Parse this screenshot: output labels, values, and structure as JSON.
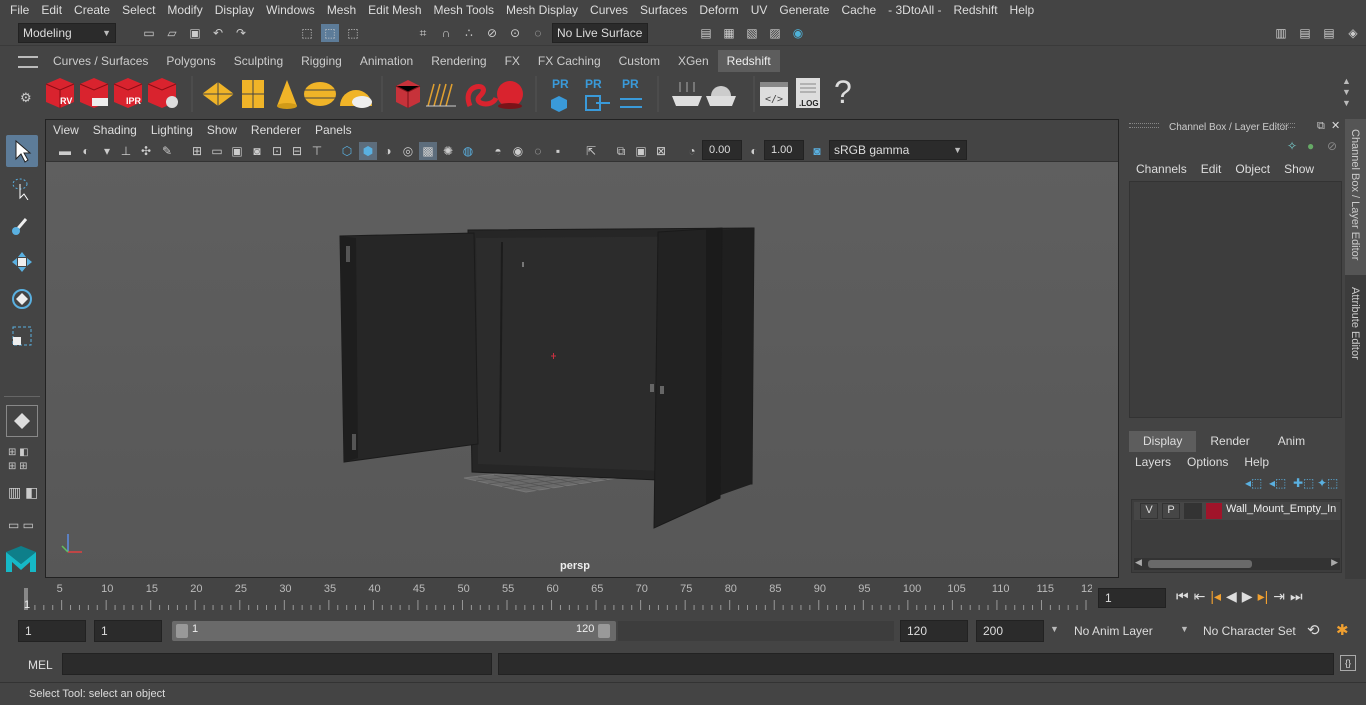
{
  "menu": [
    "File",
    "Edit",
    "Create",
    "Select",
    "Modify",
    "Display",
    "Windows",
    "Mesh",
    "Edit Mesh",
    "Mesh Tools",
    "Mesh Display",
    "Curves",
    "Surfaces",
    "Deform",
    "UV",
    "Generate",
    "Cache",
    "- 3DtoAll -",
    "Redshift",
    "Help"
  ],
  "status": {
    "mode": "Modeling",
    "live_surface": "No Live Surface"
  },
  "shelf_tabs": [
    "Curves / Surfaces",
    "Polygons",
    "Sculpting",
    "Rigging",
    "Animation",
    "Rendering",
    "FX",
    "FX Caching",
    "Custom",
    "XGen",
    "Redshift"
  ],
  "shelf_active": "Redshift",
  "shelf_labels": {
    "rv": "RV",
    "ipr": "IPR",
    "pr1": "PR",
    "pr2": "PR",
    "pr3": "PR",
    "log": ".LOG",
    "help": "?"
  },
  "viewport": {
    "menu": [
      "View",
      "Shading",
      "Lighting",
      "Show",
      "Renderer",
      "Panels"
    ],
    "exposure": "0.00",
    "gamma": "1.00",
    "color_space": "sRGB gamma",
    "camera": "persp"
  },
  "channel_box": {
    "title": "Channel Box / Layer Editor",
    "menu": [
      "Channels",
      "Edit",
      "Object",
      "Show"
    ],
    "layer_tabs": [
      "Display",
      "Render",
      "Anim"
    ],
    "layer_menu": [
      "Layers",
      "Options",
      "Help"
    ],
    "layer_row": {
      "v": "V",
      "p": "P",
      "name": "Wall_Mount_Empty_In",
      "color": "#a0142a"
    }
  },
  "side_tabs": {
    "channel": "Channel Box / Layer Editor",
    "attribute": "Attribute Editor"
  },
  "timeline": {
    "ticks": [
      "5",
      "10",
      "15",
      "20",
      "25",
      "30",
      "35",
      "40",
      "45",
      "50",
      "55",
      "60",
      "65",
      "70",
      "75",
      "80",
      "85",
      "90",
      "95",
      "100",
      "105",
      "110",
      "115",
      "12"
    ],
    "start_label": "1",
    "current_frame": "1"
  },
  "range": {
    "start": "1",
    "playback_start": "1",
    "slider_start": "1",
    "slider_end": "120",
    "end": "120",
    "anim_end": "200",
    "anim_layer": "No Anim Layer",
    "character_set": "No Character Set"
  },
  "mel": {
    "label": "MEL"
  },
  "help_line": "Select Tool: select an object"
}
